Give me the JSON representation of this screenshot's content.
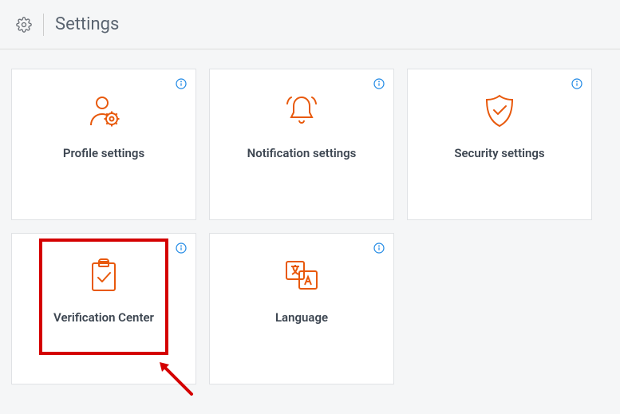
{
  "header": {
    "title": "Settings"
  },
  "cards": [
    {
      "label": "Profile settings"
    },
    {
      "label": "Notification settings"
    },
    {
      "label": "Security settings"
    },
    {
      "label": "Verification Center"
    },
    {
      "label": "Language"
    }
  ],
  "colors": {
    "accent": "#e8590c",
    "highlight": "#d40000",
    "info": "#1e88e5"
  }
}
